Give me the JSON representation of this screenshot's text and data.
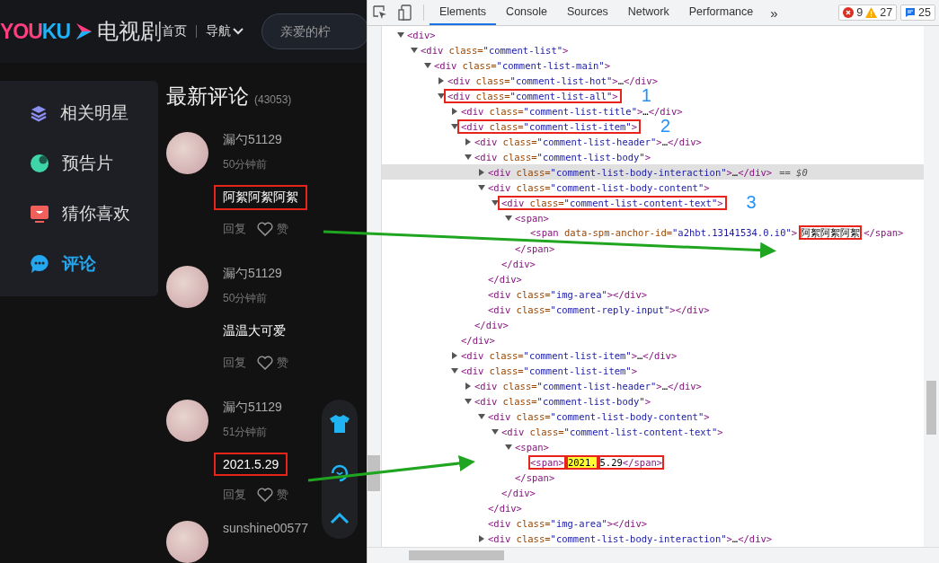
{
  "page": {
    "logo": "YOUKU",
    "channel": "电视剧",
    "nav": [
      {
        "label": "首页",
        "kind": "link"
      },
      {
        "label": "导航",
        "kind": "dropdown"
      }
    ],
    "search": {
      "placeholder": "亲爱的柠"
    },
    "sidebar": {
      "items": [
        {
          "label": "相关明星",
          "kind": "stars",
          "selected": false
        },
        {
          "label": "预告片",
          "kind": "trailer",
          "selected": false
        },
        {
          "label": "猜你喜欢",
          "kind": "picks",
          "selected": false
        },
        {
          "label": "评论",
          "kind": "comments",
          "selected": true
        }
      ]
    },
    "comments": {
      "title": "最新评论",
      "count": "(43053)",
      "items": [
        {
          "user": "漏勺51129",
          "time": "50分钟前",
          "text": "阿絮阿絮阿絮",
          "boxed": true,
          "reply": "回复",
          "like": "赞"
        },
        {
          "user": "漏勺51129",
          "time": "50分钟前",
          "text": "温温大可爱",
          "boxed": false,
          "reply": "回复",
          "like": "赞"
        },
        {
          "user": "漏勺51129",
          "time": "51分钟前",
          "text": "2021.5.29",
          "boxed": true,
          "reply": "回复",
          "like": "赞"
        },
        {
          "user": "sunshine00577"
        }
      ]
    }
  },
  "devtools": {
    "tabs": [
      {
        "label": "Elements",
        "selected": true
      },
      {
        "label": "Console",
        "selected": false
      },
      {
        "label": "Sources",
        "selected": false
      },
      {
        "label": "Network",
        "selected": false
      },
      {
        "label": "Performance",
        "selected": false
      }
    ],
    "more": "»",
    "errors": "9",
    "warnings": "27",
    "messages": "25",
    "tree": [
      {
        "text": "<div>",
        "kind": "branch",
        "expanded": true,
        "selected": false,
        "children": [
          {
            "text": "<div class=\"comment-list\">",
            "kind": "branch",
            "expanded": true,
            "selected": false,
            "children": [
              {
                "text": "<div class=\"comment-list-main\">",
                "kind": "branch",
                "expanded": true,
                "selected": false,
                "children": [
                  {
                    "text": "<div class=\"comment-list-hot\">…</div>",
                    "kind": "branch",
                    "expanded": false,
                    "selected": false
                  },
                  {
                    "text": "<div class=\"comment-list-all\">",
                    "kind": "branch",
                    "expanded": true,
                    "selected": false,
                    "boxed": true,
                    "marker": "1",
                    "children": [
                      {
                        "text": "<div class=\"comment-list-title\">…</div>",
                        "kind": "branch",
                        "expanded": false,
                        "selected": false
                      },
                      {
                        "text": "<div class=\"comment-list-item\">",
                        "kind": "branch",
                        "expanded": true,
                        "selected": false,
                        "boxed": true,
                        "marker": "2",
                        "closing": "</div>",
                        "children": [
                          {
                            "text": "<div class=\"comment-list-header\">…</div>",
                            "kind": "branch",
                            "expanded": false,
                            "selected": false
                          },
                          {
                            "text": "<div class=\"comment-list-body\">",
                            "kind": "branch",
                            "expanded": true,
                            "selected": false,
                            "closing": "</div>",
                            "children": [
                              {
                                "text": "<div class=\"comment-list-body-interaction\">…</div>",
                                "kind": "branch",
                                "expanded": false,
                                "selected": true,
                                "suffix": "== $0"
                              },
                              {
                                "text": "<div class=\"comment-list-body-content\">",
                                "kind": "branch",
                                "expanded": true,
                                "selected": false,
                                "closing": "</div>",
                                "children": [
                                  {
                                    "text": "<div class=\"comment-list-content-text\">",
                                    "kind": "branch",
                                    "expanded": true,
                                    "selected": false,
                                    "boxed": true,
                                    "marker": "3",
                                    "closing": "</div>",
                                    "children": [
                                      {
                                        "text": "<span>",
                                        "kind": "branch",
                                        "expanded": true,
                                        "selected": false,
                                        "closing": "</span>",
                                        "children": [
                                          {
                                            "parts": [
                                              {
                                                "text": "<span data-spm-anchor-id=\"a2hbt.13141534.0.i0\">",
                                                "highlight": false,
                                                "boxed": false
                                              },
                                              {
                                                "text": "阿絮阿絮阿絮",
                                                "highlight": false,
                                                "boxed": true
                                              },
                                              {
                                                "text": "</span>",
                                                "highlight": false,
                                                "boxed": false
                                              }
                                            ],
                                            "kind": "leaf",
                                            "selected": false
                                          }
                                        ]
                                      }
                                    ]
                                  }
                                ]
                              },
                              {
                                "text": "<div class=\"img-area\"></div>",
                                "kind": "leaf",
                                "selected": false
                              },
                              {
                                "text": "<div class=\"comment-reply-input\"></div>",
                                "kind": "leaf",
                                "selected": false
                              }
                            ]
                          }
                        ]
                      },
                      {
                        "text": "<div class=\"comment-list-item\">…</div>",
                        "kind": "branch",
                        "expanded": false,
                        "selected": false
                      },
                      {
                        "text": "<div class=\"comment-list-item\">",
                        "kind": "branch",
                        "expanded": true,
                        "selected": false,
                        "children": [
                          {
                            "text": "<div class=\"comment-list-header\">…</div>",
                            "kind": "branch",
                            "expanded": false,
                            "selected": false
                          },
                          {
                            "text": "<div class=\"comment-list-body\">",
                            "kind": "branch",
                            "expanded": true,
                            "selected": false,
                            "children": [
                              {
                                "text": "<div class=\"comment-list-body-content\">",
                                "kind": "branch",
                                "expanded": true,
                                "selected": false,
                                "closing": "</div>",
                                "children": [
                                  {
                                    "text": "<div class=\"comment-list-content-text\">",
                                    "kind": "branch",
                                    "expanded": true,
                                    "selected": false,
                                    "closing": "</div>",
                                    "children": [
                                      {
                                        "text": "<span>",
                                        "kind": "branch",
                                        "expanded": true,
                                        "selected": false,
                                        "closing": "</span>",
                                        "children": [
                                          {
                                            "parts": [
                                              {
                                                "text": "<span>",
                                                "highlight": false,
                                                "boxed": true
                                              },
                                              {
                                                "text": "2021.",
                                                "highlight": true,
                                                "boxed": true
                                              },
                                              {
                                                "text": "5.29</span>",
                                                "highlight": false,
                                                "boxed": true
                                              }
                                            ],
                                            "kind": "leaf",
                                            "selected": false
                                          }
                                        ]
                                      }
                                    ]
                                  }
                                ]
                              },
                              {
                                "text": "<div class=\"img-area\"></div>",
                                "kind": "leaf",
                                "selected": false
                              },
                              {
                                "text": "<div class=\"comment-list-body-interaction\">…</div>",
                                "kind": "branch",
                                "expanded": false,
                                "selected": false
                              }
                            ]
                          }
                        ]
                      }
                    ]
                  }
                ]
              }
            ]
          }
        ]
      }
    ]
  }
}
